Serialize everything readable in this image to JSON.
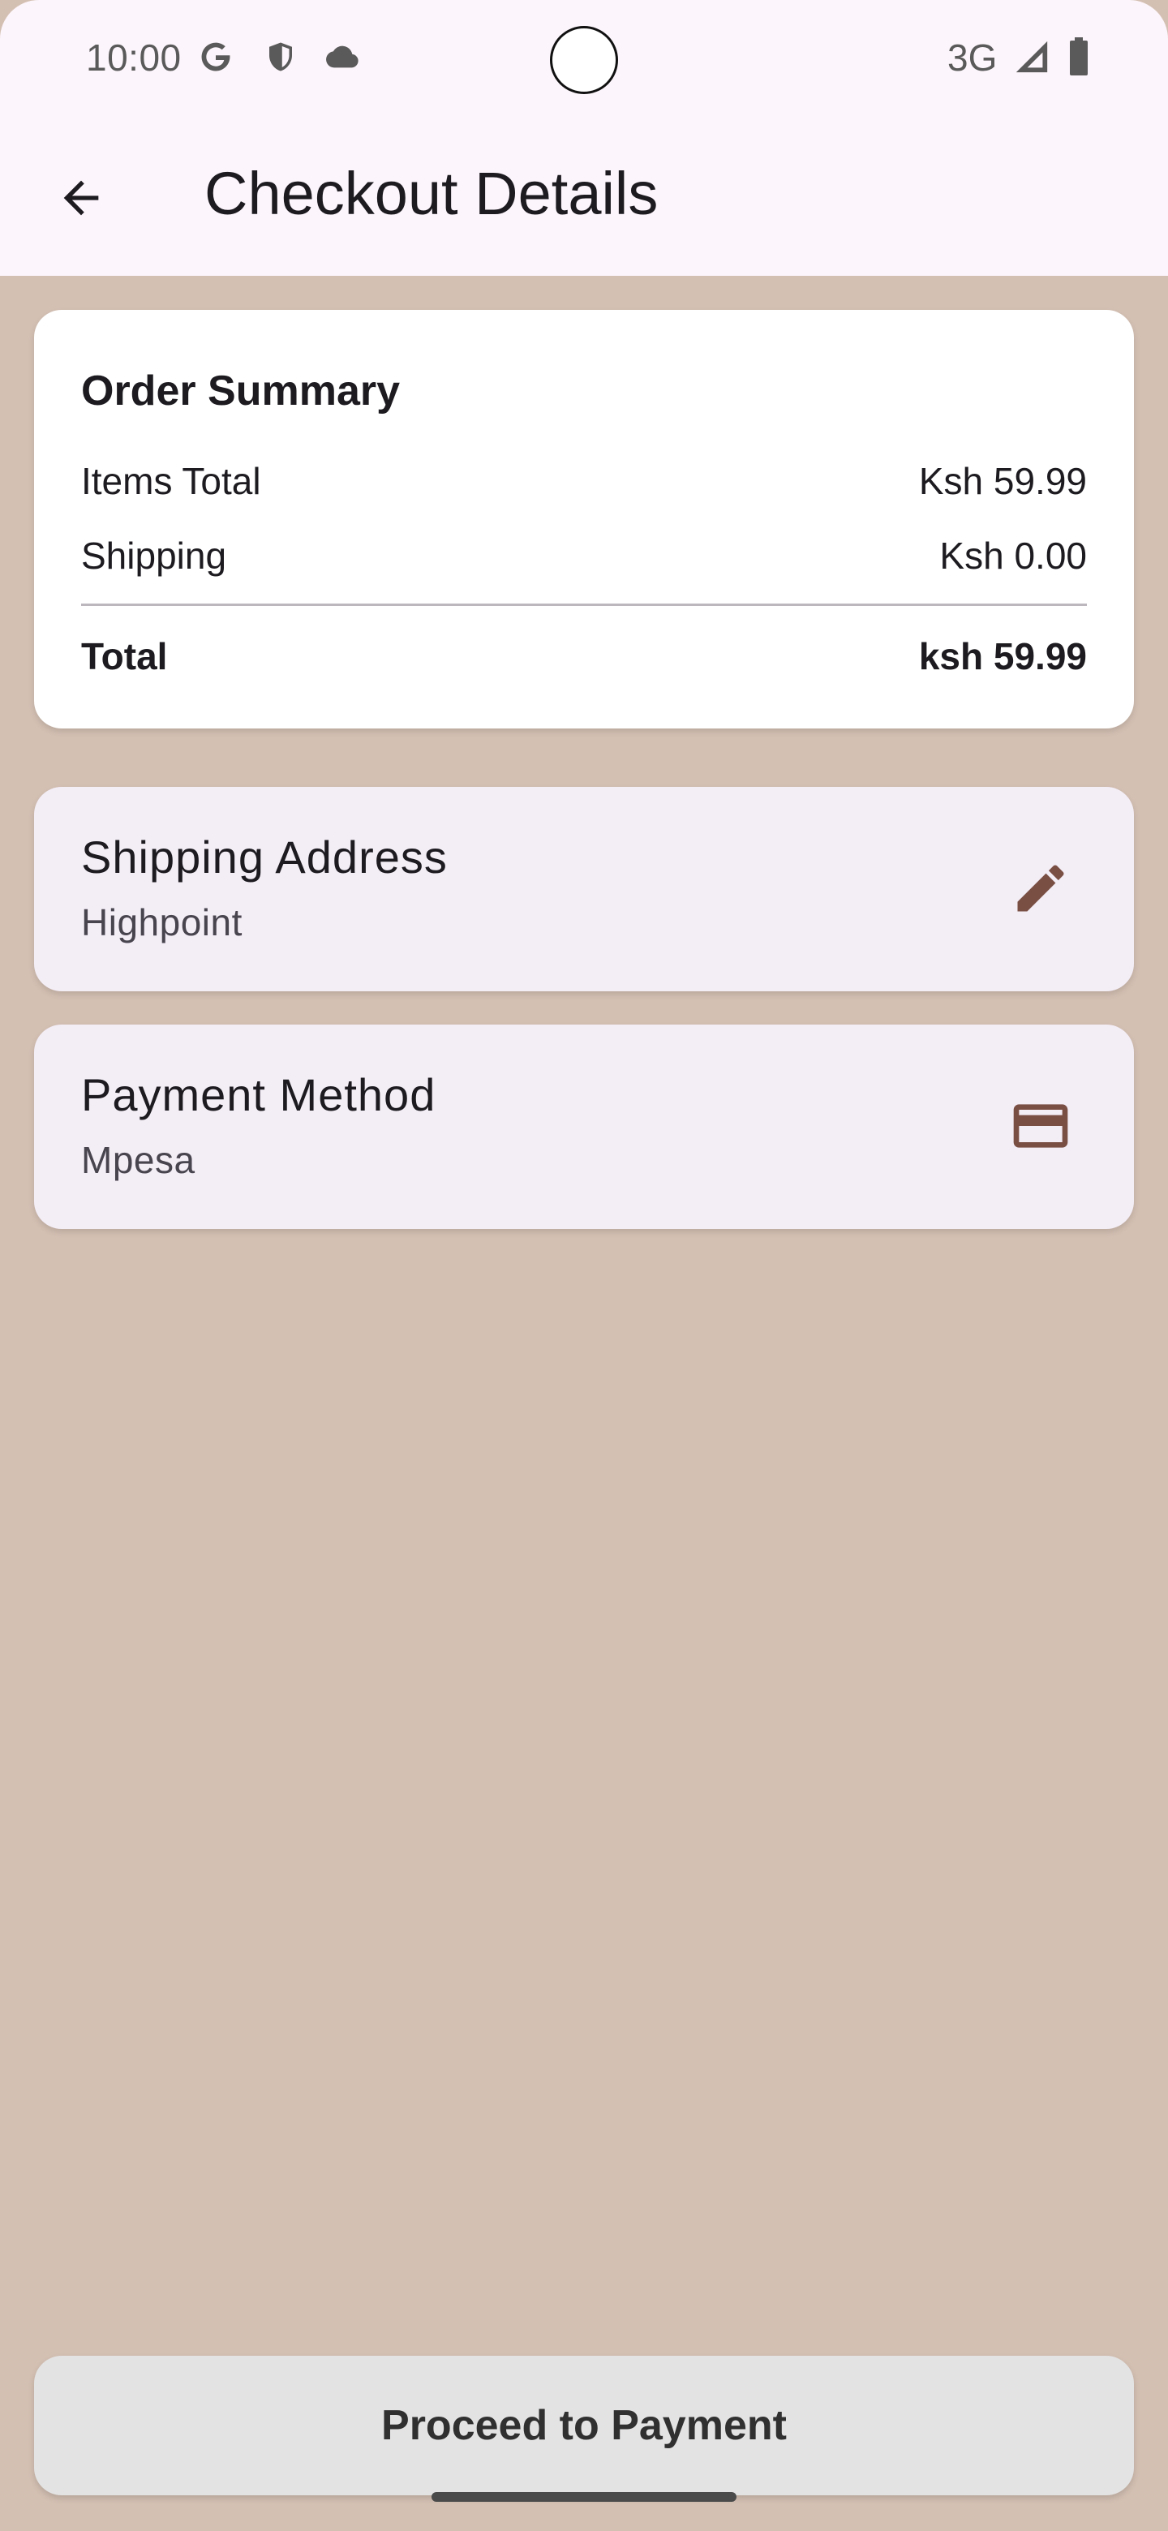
{
  "status_bar": {
    "time": "10:00",
    "network": "3G",
    "icons": [
      "google-icon",
      "shield-icon",
      "cloud-icon",
      "signal-icon",
      "battery-icon"
    ]
  },
  "app_bar": {
    "title": "Checkout Details",
    "back_icon": "arrow-back-icon"
  },
  "order_summary": {
    "title": "Order Summary",
    "rows": [
      {
        "label": "Items Total",
        "value": "Ksh 59.99"
      },
      {
        "label": "Shipping",
        "value": "Ksh 0.00"
      }
    ],
    "total": {
      "label": "Total",
      "value": "ksh 59.99"
    }
  },
  "shipping_address": {
    "title": "Shipping Address",
    "value": "Highpoint",
    "icon": "edit-icon"
  },
  "payment_method": {
    "title": "Payment Method",
    "value": "Mpesa",
    "icon": "credit-card-icon"
  },
  "actions": {
    "proceed_label": "Proceed to Payment"
  },
  "colors": {
    "background": "#d4c0b3",
    "app_bar": "#fcf5fb",
    "card": "#ffffff",
    "info_card": "#f3edf6",
    "accent_icon": "#7a4f43",
    "button": "#e3e3e3"
  }
}
